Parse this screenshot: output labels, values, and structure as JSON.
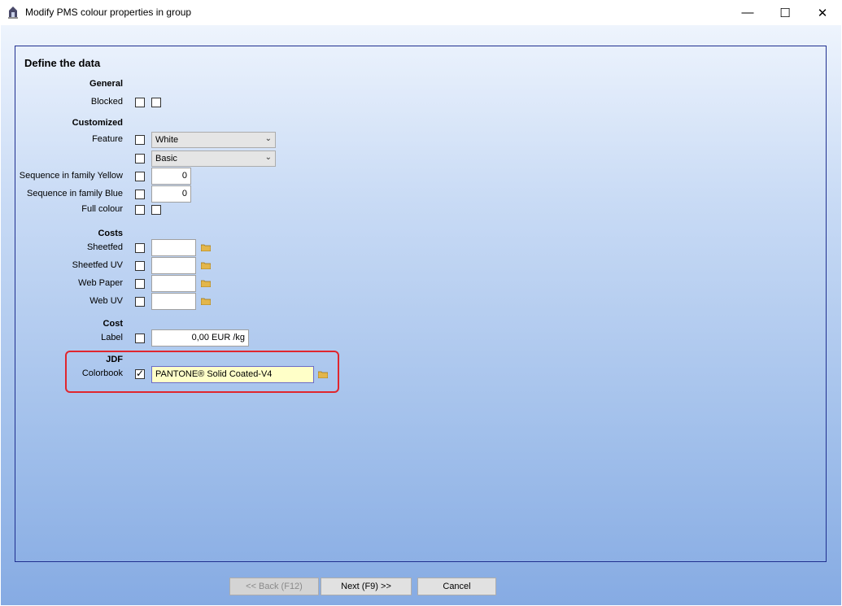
{
  "window": {
    "title": "Modify PMS colour properties in group",
    "minimize": "—",
    "maximize": "☐",
    "close": "✕"
  },
  "panel_title": "Define the data",
  "sections": {
    "general": "General",
    "customized": "Customized",
    "costs": "Costs",
    "cost": "Cost",
    "jdf": "JDF"
  },
  "labels": {
    "blocked": "Blocked",
    "feature": "Feature",
    "seq_yellow": "Sequence in family Yellow",
    "seq_blue": "Sequence in family Blue",
    "full_colour": "Full colour",
    "sheetfed": "Sheetfed",
    "sheetfed_uv": "Sheetfed UV",
    "web_paper": "Web Paper",
    "web_uv": "Web UV",
    "label": "Label",
    "colorbook": "Colorbook"
  },
  "values": {
    "feature_select": "White",
    "feature_select2": "Basic",
    "seq_yellow": "0",
    "seq_blue": "0",
    "label_cost": "0,00 EUR /kg",
    "colorbook": "PANTONE® Solid Coated-V4"
  },
  "buttons": {
    "back": "<< Back (F12)",
    "next": "Next (F9) >>",
    "cancel": "Cancel"
  },
  "colors": {
    "highlight": "#e0262e",
    "panel_border": "#1f2f8f"
  }
}
